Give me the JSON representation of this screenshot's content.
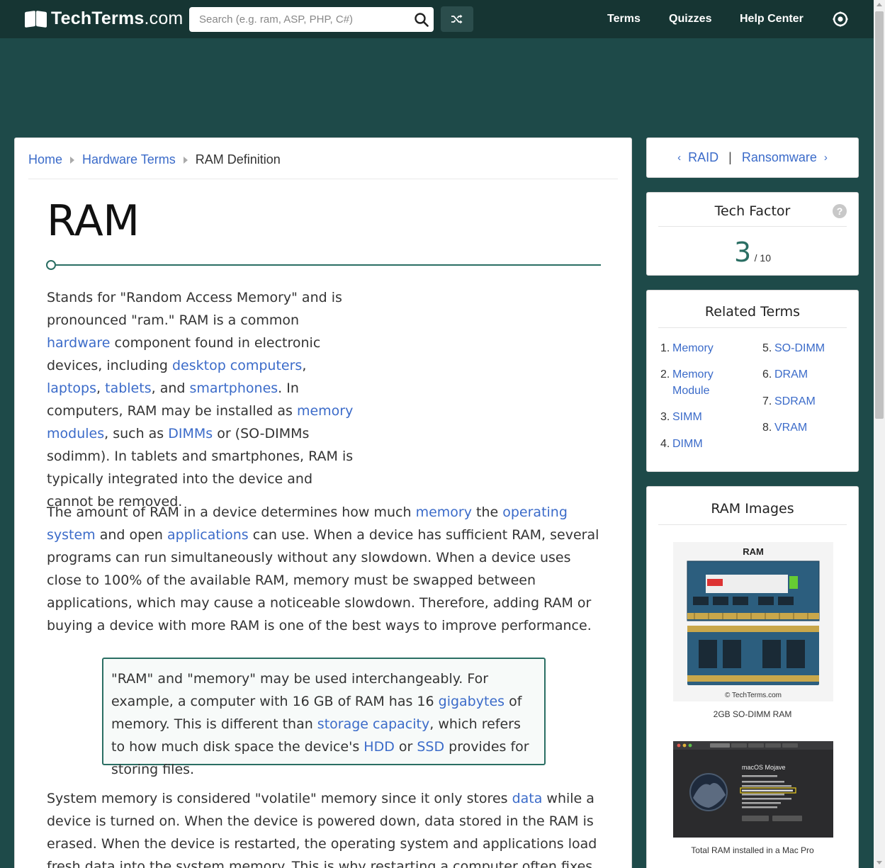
{
  "nav": {
    "logo_bold": "TechTerms",
    "logo_rest": ".com",
    "search_placeholder": "Search (e.g. ram, ASP, PHP, C#)",
    "links": [
      "Terms",
      "Quizzes",
      "Help Center"
    ]
  },
  "breadcrumb": {
    "home": "Home",
    "category": "Hardware Terms",
    "current": "RAM Definition"
  },
  "article": {
    "title": "RAM",
    "p1": [
      {
        "t": "Stands for \"Random Access Memory\" and is pronounced \"ram.\" RAM is a common "
      },
      {
        "t": "hardware",
        "link": true
      },
      {
        "t": " component found in electronic devices, including "
      },
      {
        "t": "desktop computers",
        "link": true
      },
      {
        "t": ", "
      },
      {
        "t": "laptops",
        "link": true
      },
      {
        "t": ", "
      },
      {
        "t": "tablets",
        "link": true
      },
      {
        "t": ", and "
      },
      {
        "t": "smartphones",
        "link": true
      },
      {
        "t": ". In computers, RAM may be installed as "
      },
      {
        "t": "memory modules",
        "link": true
      },
      {
        "t": ", such as "
      },
      {
        "t": "DIMMs",
        "link": true
      },
      {
        "t": " or (SO-DIMMs sodimm). In tablets and smartphones, RAM is typically integrated into the device and cannot be removed."
      }
    ],
    "p2": [
      {
        "t": "The amount of RAM in a device determines how much "
      },
      {
        "t": "memory",
        "link": true
      },
      {
        "t": " the "
      },
      {
        "t": "operating system",
        "link": true
      },
      {
        "t": " and open "
      },
      {
        "t": "applications",
        "link": true
      },
      {
        "t": " can use. When a device has sufficient RAM, several programs can run simultaneously without any slowdown. When a device uses close to 100% of the available RAM, memory must be swapped between applications, which may cause a noticeable slowdown. Therefore, adding RAM or buying a device with more RAM is one of the best ways to improve performance."
      }
    ],
    "note": [
      {
        "t": "\"RAM\" and \"memory\" may be used interchangeably. For example, a computer with 16 GB of RAM has 16 "
      },
      {
        "t": "gigabytes",
        "link": true
      },
      {
        "t": " of memory. This is different than "
      },
      {
        "t": "storage capacity",
        "link": true
      },
      {
        "t": ", which refers to how much disk space the device's "
      },
      {
        "t": "HDD",
        "link": true
      },
      {
        "t": " or "
      },
      {
        "t": "SSD",
        "link": true
      },
      {
        "t": " provides for storing files."
      }
    ],
    "p4": [
      {
        "t": "System memory is considered \"volatile\" memory since it only stores "
      },
      {
        "t": "data",
        "link": true
      },
      {
        "t": " while a device is turned on. When the device is powered down, data stored in the RAM is erased. When the device is restarted, the operating system and applications load fresh data into the system memory. This is why restarting a computer often fixes problems."
      }
    ]
  },
  "prevnext": {
    "prev": "RAID",
    "separator": "|",
    "next": "Ransomware"
  },
  "tech_factor": {
    "title": "Tech Factor",
    "help": "?",
    "score": "3",
    "max": "/ 10",
    "level": 0.3
  },
  "related": {
    "title": "Related Terms",
    "items": [
      {
        "num": "1.",
        "label": "Memory"
      },
      {
        "num": "2.",
        "label": "Memory Module"
      },
      {
        "num": "3.",
        "label": "SIMM"
      },
      {
        "num": "4.",
        "label": "DIMM"
      },
      {
        "num": "5.",
        "label": "SO-DIMM"
      },
      {
        "num": "6.",
        "label": "DRAM"
      },
      {
        "num": "7.",
        "label": "SDRAM"
      },
      {
        "num": "8.",
        "label": "VRAM"
      }
    ]
  },
  "images": {
    "title": "RAM Images",
    "img1_heading": "RAM",
    "img1_watermark": "© TechTerms.com",
    "img1_caption": "2GB SO-DIMM RAM",
    "img2_os": "macOS Mojave",
    "img2_caption": "Total RAM installed in a Mac Pro"
  },
  "colors": {
    "background": "#1e4a49",
    "topbar": "#163533",
    "accent": "#2a6e63",
    "link": "#3b6bc9"
  }
}
